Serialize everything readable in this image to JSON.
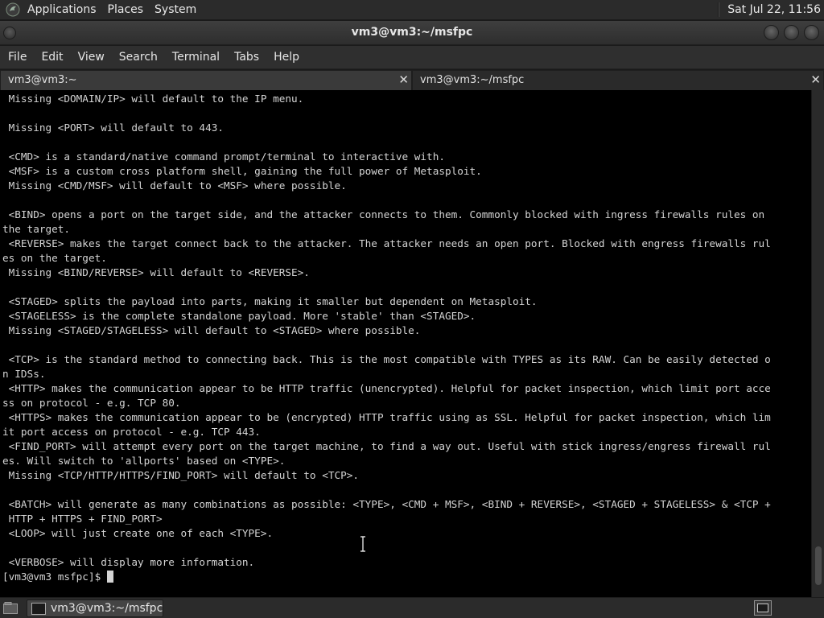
{
  "top_panel": {
    "menus": [
      "Applications",
      "Places",
      "System"
    ],
    "clock": "Sat Jul 22, 11:56"
  },
  "window": {
    "title": "vm3@vm3:~/msfpc"
  },
  "menu_bar": {
    "items": [
      "File",
      "Edit",
      "View",
      "Search",
      "Terminal",
      "Tabs",
      "Help"
    ]
  },
  "tabs": [
    {
      "label": "vm3@vm3:~",
      "active": false
    },
    {
      "label": "vm3@vm3:~/msfpc",
      "active": true
    }
  ],
  "terminal": {
    "lines": [
      " Missing <DOMAIN/IP> will default to the IP menu.",
      "",
      " Missing <PORT> will default to 443.",
      "",
      " <CMD> is a standard/native command prompt/terminal to interactive with.",
      " <MSF> is a custom cross platform shell, gaining the full power of Metasploit.",
      " Missing <CMD/MSF> will default to <MSF> where possible.",
      "",
      " <BIND> opens a port on the target side, and the attacker connects to them. Commonly blocked with ingress firewalls rules on",
      "the target.",
      " <REVERSE> makes the target connect back to the attacker. The attacker needs an open port. Blocked with engress firewalls rul",
      "es on the target.",
      " Missing <BIND/REVERSE> will default to <REVERSE>.",
      "",
      " <STAGED> splits the payload into parts, making it smaller but dependent on Metasploit.",
      " <STAGELESS> is the complete standalone payload. More 'stable' than <STAGED>.",
      " Missing <STAGED/STAGELESS> will default to <STAGED> where possible.",
      "",
      " <TCP> is the standard method to connecting back. This is the most compatible with TYPES as its RAW. Can be easily detected o",
      "n IDSs.",
      " <HTTP> makes the communication appear to be HTTP traffic (unencrypted). Helpful for packet inspection, which limit port acce",
      "ss on protocol - e.g. TCP 80.",
      " <HTTPS> makes the communication appear to be (encrypted) HTTP traffic using as SSL. Helpful for packet inspection, which lim",
      "it port access on protocol - e.g. TCP 443.",
      " <FIND_PORT> will attempt every port on the target machine, to find a way out. Useful with stick ingress/engress firewall rul",
      "es. Will switch to 'allports' based on <TYPE>.",
      " Missing <TCP/HTTP/HTTPS/FIND_PORT> will default to <TCP>.",
      "",
      " <BATCH> will generate as many combinations as possible: <TYPE>, <CMD + MSF>, <BIND + REVERSE>, <STAGED + STAGELESS> & <TCP +",
      " HTTP + HTTPS + FIND_PORT>",
      " <LOOP> will just create one of each <TYPE>.",
      "",
      " <VERBOSE> will display more information."
    ],
    "prompt": "[vm3@vm3 msfpc]$ "
  },
  "scrollbar": {
    "position": 0.98
  },
  "taskbar": {
    "window_label": "vm3@vm3:~/msfpc"
  },
  "icons": {
    "app_logo": "kali-dragon-icon",
    "show_desktop": "show-desktop-icon",
    "terminal": "terminal-icon",
    "workspace": "workspace-switcher-icon"
  }
}
